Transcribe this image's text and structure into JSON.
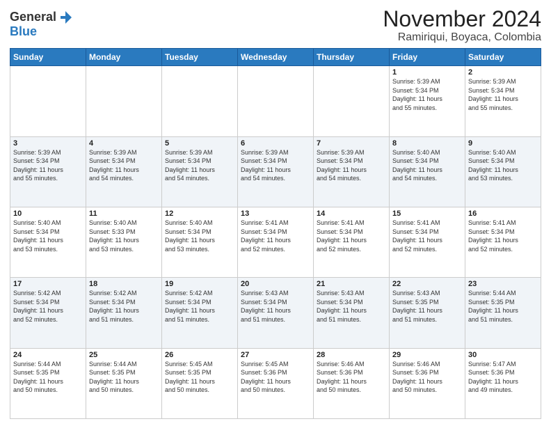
{
  "header": {
    "logo_general": "General",
    "logo_blue": "Blue",
    "title": "November 2024",
    "subtitle": "Ramiriqui, Boyaca, Colombia"
  },
  "weekdays": [
    "Sunday",
    "Monday",
    "Tuesday",
    "Wednesday",
    "Thursday",
    "Friday",
    "Saturday"
  ],
  "weeks": [
    [
      {
        "day": "",
        "info": ""
      },
      {
        "day": "",
        "info": ""
      },
      {
        "day": "",
        "info": ""
      },
      {
        "day": "",
        "info": ""
      },
      {
        "day": "",
        "info": ""
      },
      {
        "day": "1",
        "info": "Sunrise: 5:39 AM\nSunset: 5:34 PM\nDaylight: 11 hours\nand 55 minutes."
      },
      {
        "day": "2",
        "info": "Sunrise: 5:39 AM\nSunset: 5:34 PM\nDaylight: 11 hours\nand 55 minutes."
      }
    ],
    [
      {
        "day": "3",
        "info": "Sunrise: 5:39 AM\nSunset: 5:34 PM\nDaylight: 11 hours\nand 55 minutes."
      },
      {
        "day": "4",
        "info": "Sunrise: 5:39 AM\nSunset: 5:34 PM\nDaylight: 11 hours\nand 54 minutes."
      },
      {
        "day": "5",
        "info": "Sunrise: 5:39 AM\nSunset: 5:34 PM\nDaylight: 11 hours\nand 54 minutes."
      },
      {
        "day": "6",
        "info": "Sunrise: 5:39 AM\nSunset: 5:34 PM\nDaylight: 11 hours\nand 54 minutes."
      },
      {
        "day": "7",
        "info": "Sunrise: 5:39 AM\nSunset: 5:34 PM\nDaylight: 11 hours\nand 54 minutes."
      },
      {
        "day": "8",
        "info": "Sunrise: 5:40 AM\nSunset: 5:34 PM\nDaylight: 11 hours\nand 54 minutes."
      },
      {
        "day": "9",
        "info": "Sunrise: 5:40 AM\nSunset: 5:34 PM\nDaylight: 11 hours\nand 53 minutes."
      }
    ],
    [
      {
        "day": "10",
        "info": "Sunrise: 5:40 AM\nSunset: 5:34 PM\nDaylight: 11 hours\nand 53 minutes."
      },
      {
        "day": "11",
        "info": "Sunrise: 5:40 AM\nSunset: 5:33 PM\nDaylight: 11 hours\nand 53 minutes."
      },
      {
        "day": "12",
        "info": "Sunrise: 5:40 AM\nSunset: 5:34 PM\nDaylight: 11 hours\nand 53 minutes."
      },
      {
        "day": "13",
        "info": "Sunrise: 5:41 AM\nSunset: 5:34 PM\nDaylight: 11 hours\nand 52 minutes."
      },
      {
        "day": "14",
        "info": "Sunrise: 5:41 AM\nSunset: 5:34 PM\nDaylight: 11 hours\nand 52 minutes."
      },
      {
        "day": "15",
        "info": "Sunrise: 5:41 AM\nSunset: 5:34 PM\nDaylight: 11 hours\nand 52 minutes."
      },
      {
        "day": "16",
        "info": "Sunrise: 5:41 AM\nSunset: 5:34 PM\nDaylight: 11 hours\nand 52 minutes."
      }
    ],
    [
      {
        "day": "17",
        "info": "Sunrise: 5:42 AM\nSunset: 5:34 PM\nDaylight: 11 hours\nand 52 minutes."
      },
      {
        "day": "18",
        "info": "Sunrise: 5:42 AM\nSunset: 5:34 PM\nDaylight: 11 hours\nand 51 minutes."
      },
      {
        "day": "19",
        "info": "Sunrise: 5:42 AM\nSunset: 5:34 PM\nDaylight: 11 hours\nand 51 minutes."
      },
      {
        "day": "20",
        "info": "Sunrise: 5:43 AM\nSunset: 5:34 PM\nDaylight: 11 hours\nand 51 minutes."
      },
      {
        "day": "21",
        "info": "Sunrise: 5:43 AM\nSunset: 5:34 PM\nDaylight: 11 hours\nand 51 minutes."
      },
      {
        "day": "22",
        "info": "Sunrise: 5:43 AM\nSunset: 5:35 PM\nDaylight: 11 hours\nand 51 minutes."
      },
      {
        "day": "23",
        "info": "Sunrise: 5:44 AM\nSunset: 5:35 PM\nDaylight: 11 hours\nand 51 minutes."
      }
    ],
    [
      {
        "day": "24",
        "info": "Sunrise: 5:44 AM\nSunset: 5:35 PM\nDaylight: 11 hours\nand 50 minutes."
      },
      {
        "day": "25",
        "info": "Sunrise: 5:44 AM\nSunset: 5:35 PM\nDaylight: 11 hours\nand 50 minutes."
      },
      {
        "day": "26",
        "info": "Sunrise: 5:45 AM\nSunset: 5:35 PM\nDaylight: 11 hours\nand 50 minutes."
      },
      {
        "day": "27",
        "info": "Sunrise: 5:45 AM\nSunset: 5:36 PM\nDaylight: 11 hours\nand 50 minutes."
      },
      {
        "day": "28",
        "info": "Sunrise: 5:46 AM\nSunset: 5:36 PM\nDaylight: 11 hours\nand 50 minutes."
      },
      {
        "day": "29",
        "info": "Sunrise: 5:46 AM\nSunset: 5:36 PM\nDaylight: 11 hours\nand 50 minutes."
      },
      {
        "day": "30",
        "info": "Sunrise: 5:47 AM\nSunset: 5:36 PM\nDaylight: 11 hours\nand 49 minutes."
      }
    ]
  ]
}
